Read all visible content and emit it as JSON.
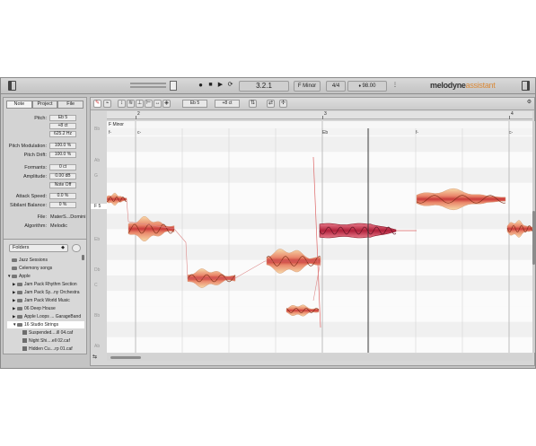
{
  "toolbar": {
    "position": "3.2.1",
    "key": "F Minor",
    "time_signature": "4/4",
    "tempo": "98.00",
    "logo_main": "melodyne",
    "logo_edition": "assistant"
  },
  "inspector": {
    "tabs": [
      "Note",
      "Project",
      "File"
    ],
    "active_tab": "Note",
    "fields": [
      {
        "label": "Pitch:",
        "value": "Eb 5"
      },
      {
        "label": "",
        "value": "+8 ct"
      },
      {
        "label": "",
        "value": "625.2 Hz"
      },
      {
        "label": "Pitch Modulation:",
        "value": "100.0 %"
      },
      {
        "label": "Pitch Drift:",
        "value": "100.0 %"
      },
      {
        "label": "Formants:",
        "value": "0 ct"
      },
      {
        "label": "Amplitude:",
        "value": "0.00 dB"
      },
      {
        "label": "",
        "value": "Note Off"
      },
      {
        "label": "Attack Speed:",
        "value": "0.0 %"
      },
      {
        "label": "Sibilant Balance:",
        "value": "0 %"
      }
    ],
    "file_label": "File:",
    "file_value": "MaterS...Domini",
    "algorithm_label": "Algorithm:",
    "algorithm_value": "Melodic"
  },
  "browser": {
    "folder_select": "Folders",
    "items": [
      {
        "label": "Jazz Sessions",
        "indent": 0,
        "type": "folder",
        "arrow": ""
      },
      {
        "label": "Celemony songs",
        "indent": 0,
        "type": "folder",
        "arrow": ""
      },
      {
        "label": "Apple",
        "indent": 0,
        "type": "folder",
        "arrow": "▼"
      },
      {
        "label": "Jam Pack Rhythm Section",
        "indent": 1,
        "type": "folder",
        "arrow": "▶"
      },
      {
        "label": "Jam Pack Sy...ny Orchestra",
        "indent": 1,
        "type": "folder",
        "arrow": "▶"
      },
      {
        "label": "Jam Pack World Music",
        "indent": 1,
        "type": "folder",
        "arrow": "▶"
      },
      {
        "label": "06 Deep House",
        "indent": 1,
        "type": "folder",
        "arrow": "▶"
      },
      {
        "label": "Apple Loops ... GarageBand",
        "indent": 1,
        "type": "folder",
        "arrow": "▶"
      },
      {
        "label": "16 Studio Strings",
        "indent": 1,
        "type": "folder",
        "arrow": "▼",
        "selected": true
      },
      {
        "label": "Suspended....ill 04.caf",
        "indent": 2,
        "type": "file",
        "arrow": ""
      },
      {
        "label": "Night Shi....ell 02.caf",
        "indent": 2,
        "type": "file",
        "arrow": ""
      },
      {
        "label": "Hidden Cu....rp 01.caf",
        "indent": 2,
        "type": "file",
        "arrow": ""
      }
    ]
  },
  "editor": {
    "pitch_field": "Eb 5",
    "cents_field": "+8 ct",
    "ruler_marks": [
      "2",
      "3",
      "4"
    ],
    "scale_name": "F Minor",
    "chord_labels": [
      "f-",
      "c-",
      "Eb",
      "f-",
      "c-"
    ],
    "key_labels": [
      "Bb",
      "Ab",
      "G",
      "F 5",
      "Eb",
      "Db",
      "C",
      "Bb",
      "Ab"
    ]
  },
  "chart_data": {
    "type": "scatter",
    "title": "",
    "note_blobs": [
      {
        "start": 0.0,
        "end": 0.05,
        "pitch": "F 5"
      },
      {
        "start": 0.05,
        "end": 0.14,
        "pitch": "E 5"
      },
      {
        "start": 0.19,
        "end": 0.25,
        "pitch": "Db 5"
      },
      {
        "start": 0.25,
        "end": 0.32,
        "pitch": "C 5"
      },
      {
        "start": 0.37,
        "end": 0.45,
        "pitch": "Db 5"
      },
      {
        "start": 0.45,
        "end": 0.53,
        "pitch": "Bb 4"
      },
      {
        "start": 0.56,
        "end": 0.82,
        "pitch": "Eb 5"
      },
      {
        "start": 0.82,
        "end": 1.0,
        "pitch": "F 5"
      }
    ]
  }
}
